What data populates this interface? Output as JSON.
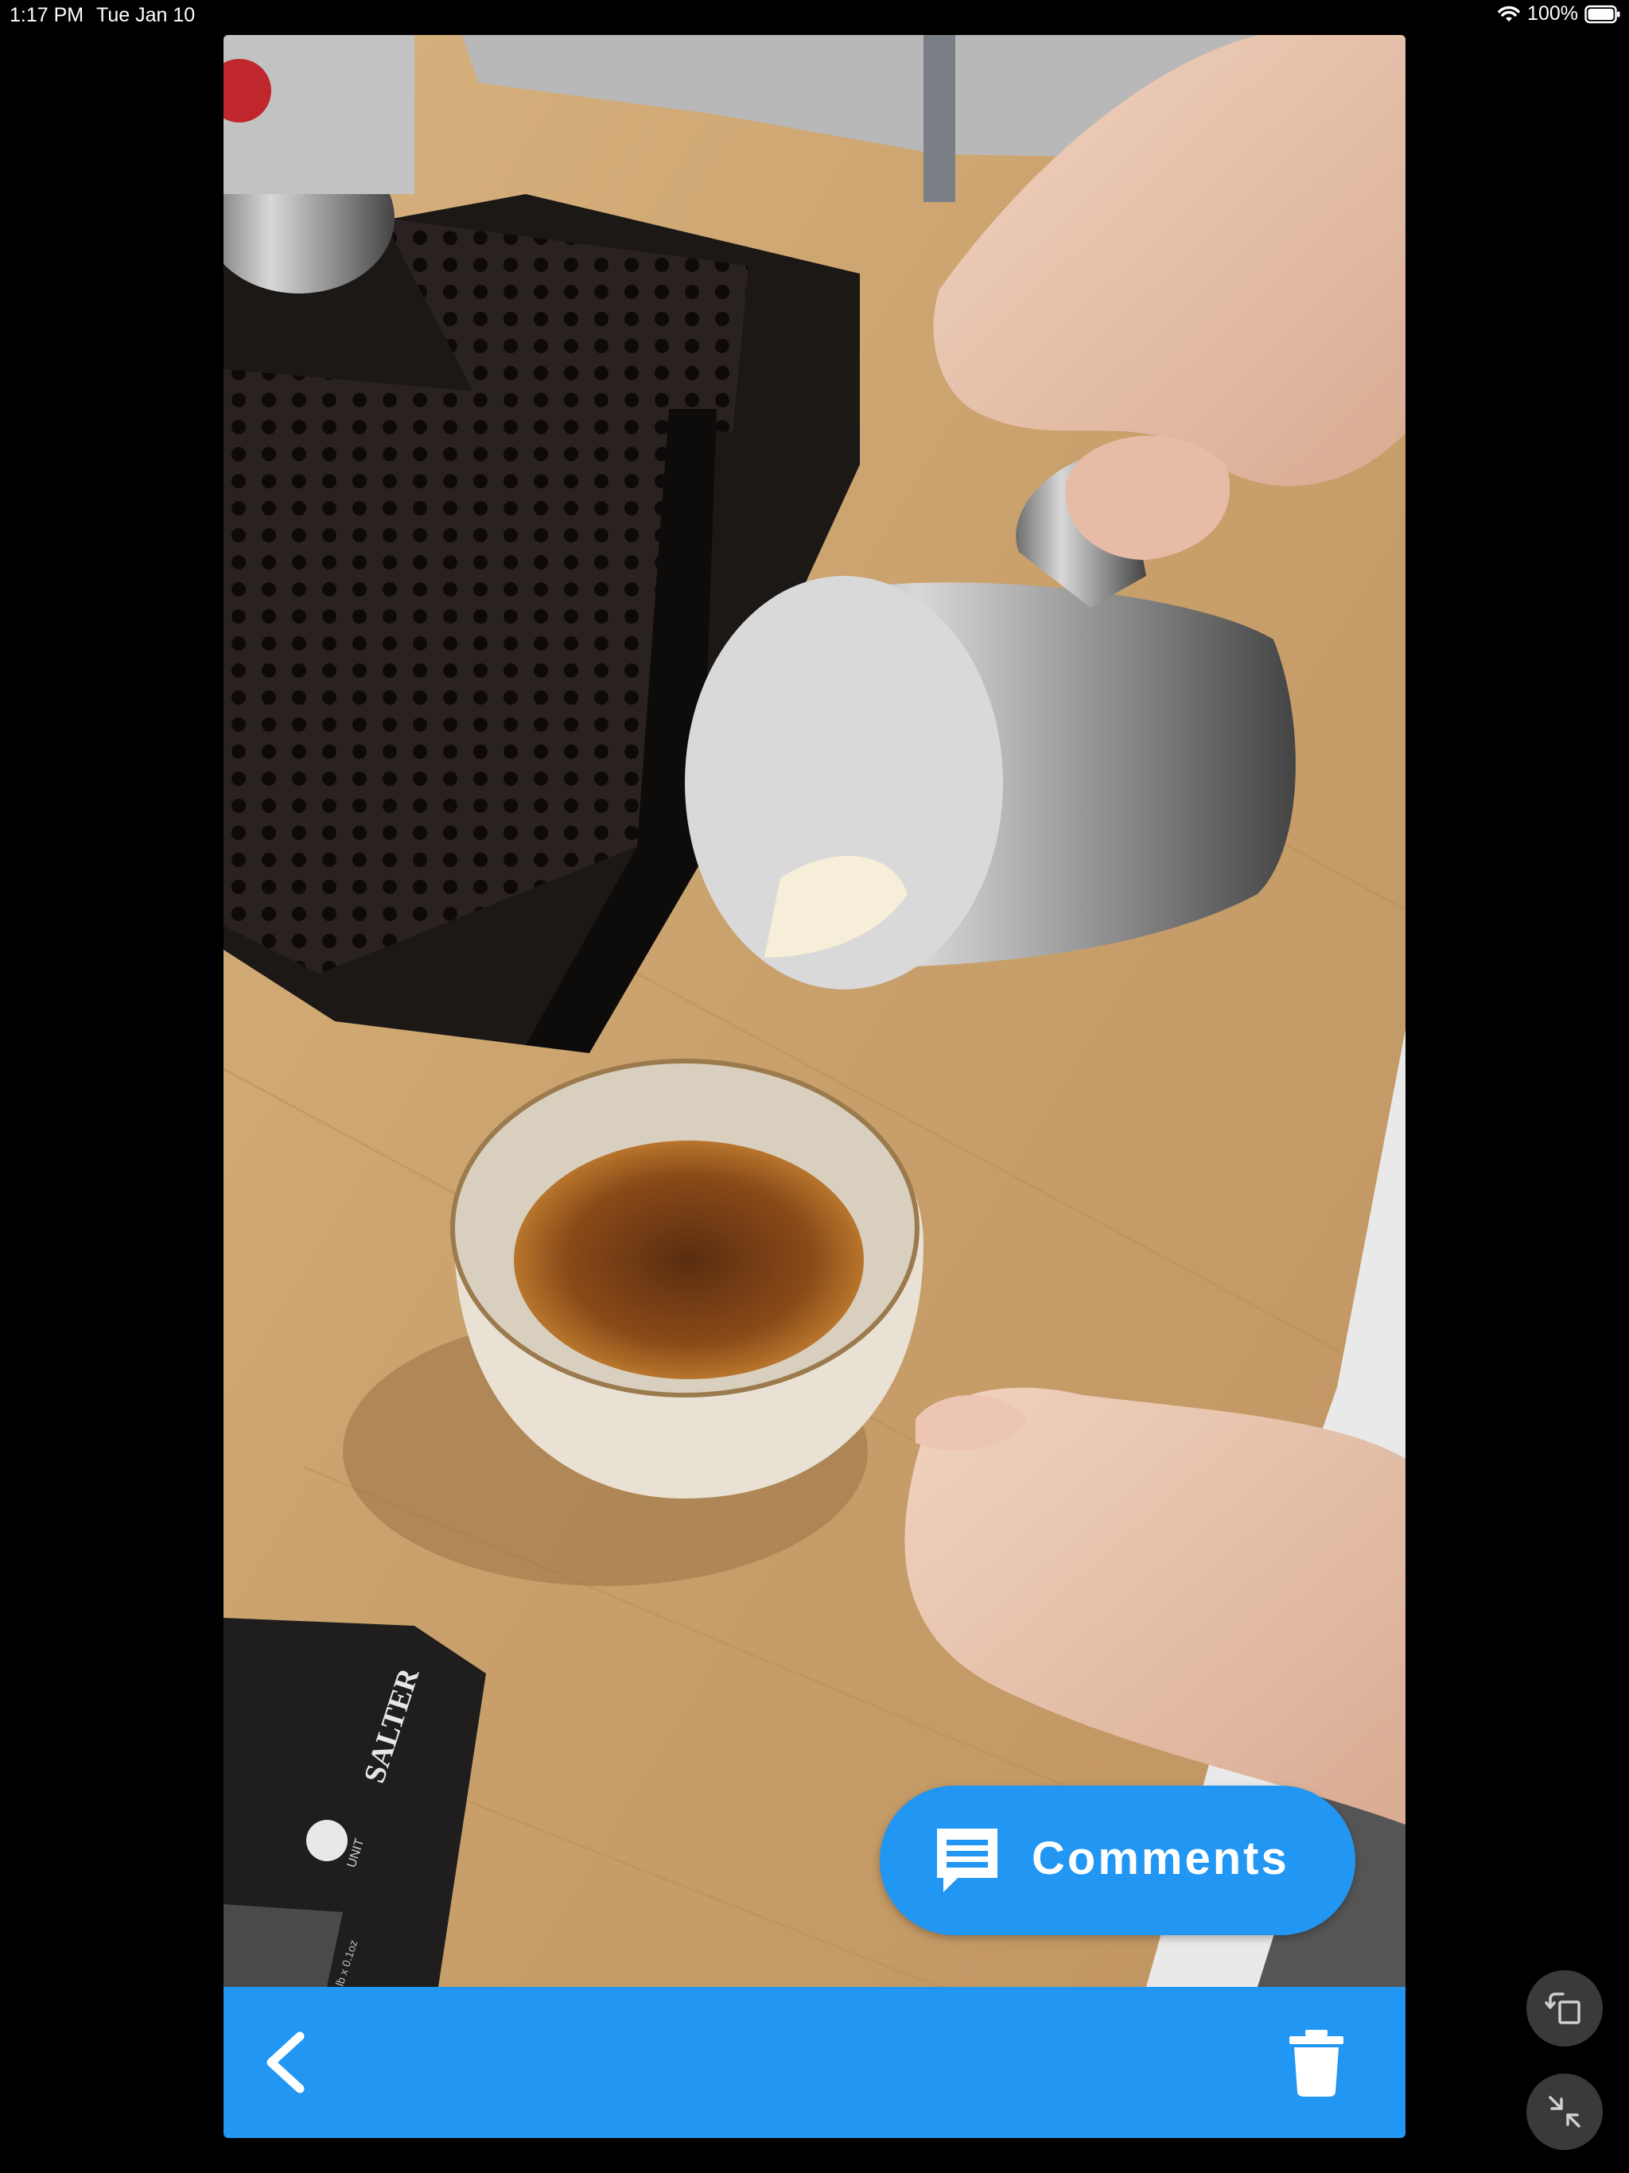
{
  "status_bar": {
    "time": "1:17 PM",
    "date": "Tue Jan 10",
    "battery": "100%"
  },
  "photo": {
    "scale_brand": "SALTER",
    "scale_unit_label": "UNIT",
    "scale_display_text": "lb x 0.1oz"
  },
  "comments_button": {
    "label": "Comments"
  },
  "bottom_bar": {
    "back_icon": "chevron-left-icon",
    "delete_icon": "trash-icon"
  },
  "floating_controls": {
    "rotate_icon": "rotate-screen-icon",
    "shrink_icon": "minimize-icon"
  },
  "colors": {
    "accent": "#2196f3",
    "background": "#000000"
  }
}
